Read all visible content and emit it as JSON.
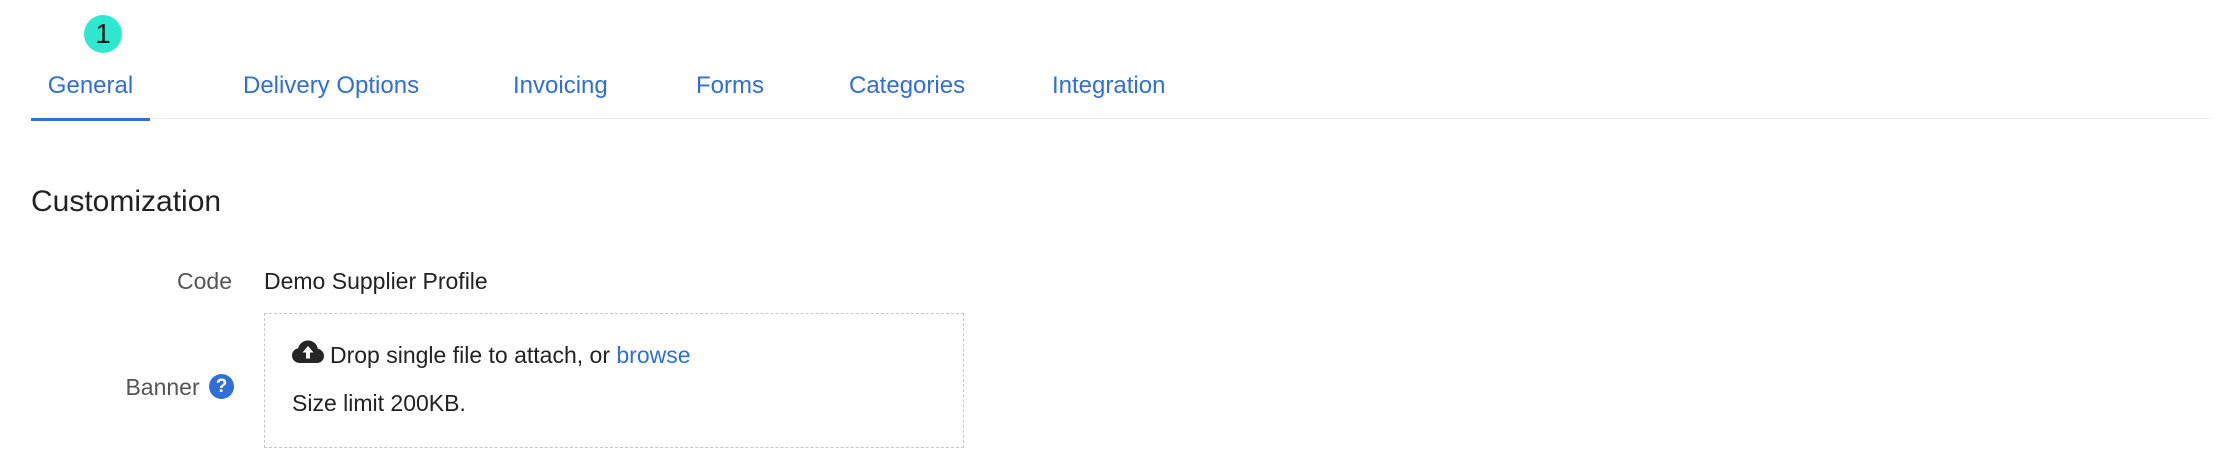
{
  "step_badge": "1",
  "tabs": [
    {
      "label": "General",
      "active": true
    },
    {
      "label": "Delivery Options",
      "active": false
    },
    {
      "label": "Invoicing",
      "active": false
    },
    {
      "label": "Forms",
      "active": false
    },
    {
      "label": "Categories",
      "active": false
    },
    {
      "label": "Integration",
      "active": false
    }
  ],
  "section": {
    "title": "Customization"
  },
  "fields": {
    "code": {
      "label": "Code",
      "value": "Demo Supplier Profile"
    },
    "banner": {
      "label": "Banner",
      "help_icon": "?",
      "drop_text": "Drop single file to attach, or",
      "browse_label": "browse",
      "size_limit": "Size limit 200KB."
    }
  },
  "colors": {
    "accent": "#2f6fd6",
    "badge": "#2ee8cf"
  },
  "icons": {
    "upload": "cloud-upload-icon",
    "help": "question-circle-icon"
  }
}
